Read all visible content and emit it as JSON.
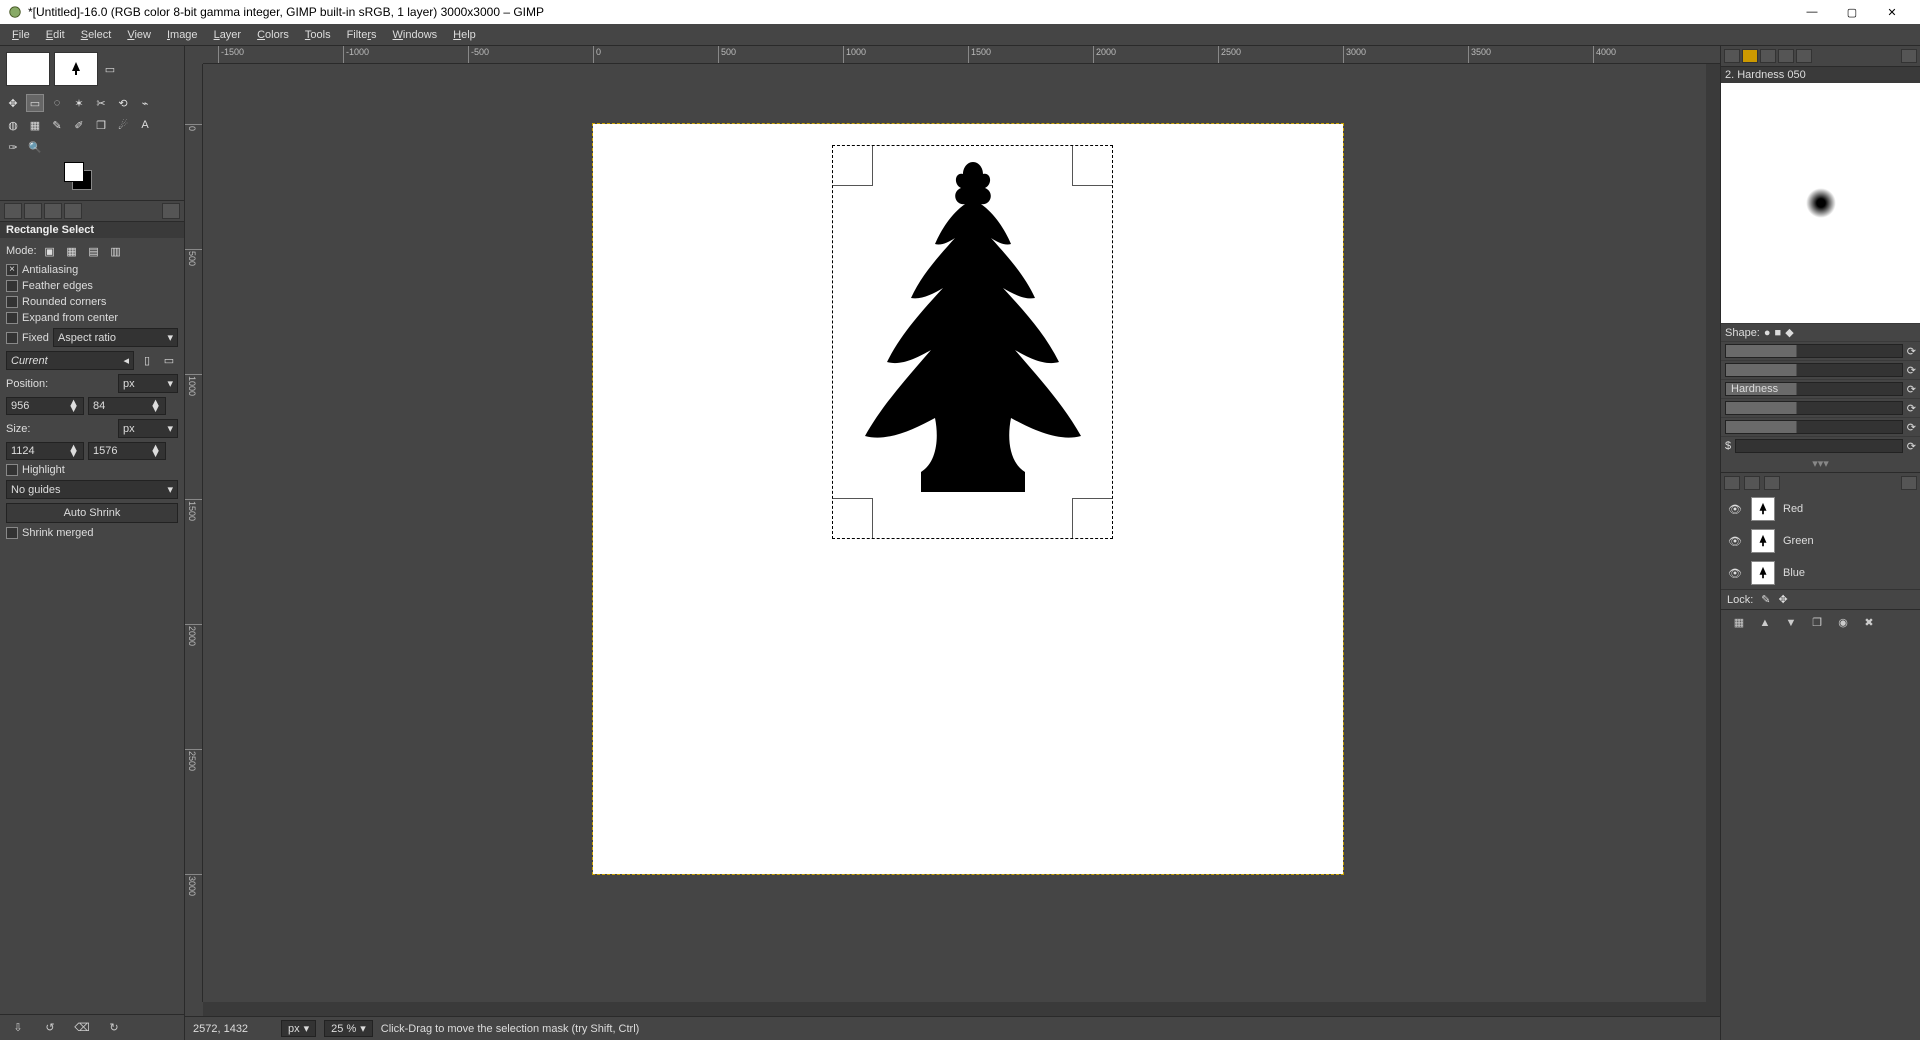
{
  "window": {
    "title": "*[Untitled]-16.0 (RGB color 8-bit gamma integer, GIMP built-in sRGB, 1 layer) 3000x3000 – GIMP"
  },
  "menu": [
    "File",
    "Edit",
    "Select",
    "View",
    "Image",
    "Layer",
    "Colors",
    "Tools",
    "Filters",
    "Windows",
    "Help"
  ],
  "tool_options": {
    "title": "Rectangle Select",
    "mode_label": "Mode:",
    "antialiasing": "Antialiasing",
    "feather": "Feather edges",
    "rounded": "Rounded corners",
    "expand": "Expand from center",
    "fixed": "Fixed",
    "fixed_mode": "Aspect ratio",
    "fixed_value": "Current",
    "position_label": "Position:",
    "position_unit": "px",
    "pos_x": "956",
    "pos_y": "84",
    "size_label": "Size:",
    "size_unit": "px",
    "size_w": "1124",
    "size_h": "1576",
    "highlight": "Highlight",
    "guides": "No guides",
    "auto_shrink": "Auto Shrink",
    "shrink_merged": "Shrink merged"
  },
  "brush": {
    "name": "2. Hardness 050",
    "shape_label": "Shape:",
    "hardness_label": "Hardness",
    "dollar": "$"
  },
  "channels": {
    "items": [
      {
        "name": "Red"
      },
      {
        "name": "Green"
      },
      {
        "name": "Blue"
      }
    ],
    "lock_label": "Lock:"
  },
  "ruler_h": [
    -1500,
    -1000,
    -500,
    0,
    500,
    1000,
    1500,
    2000,
    2500,
    3000,
    3500,
    4000
  ],
  "ruler_v": [
    0,
    500,
    1000,
    1500,
    2000,
    2500,
    3000
  ],
  "status": {
    "coords": "2572, 1432",
    "unit": "px",
    "zoom": "25 %",
    "hint": "Click-Drag to move the selection mask (try Shift, Ctrl)"
  }
}
